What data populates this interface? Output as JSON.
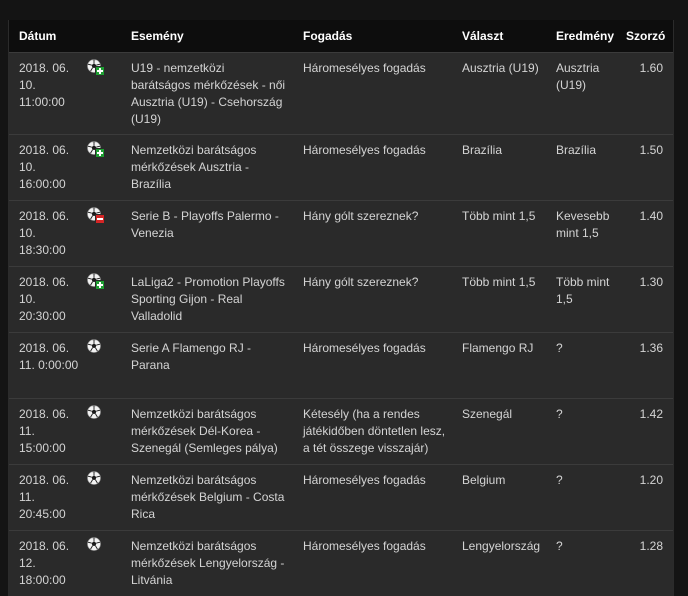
{
  "headers": {
    "date": "Dátum",
    "event": "Esemény",
    "bet": "Fogadás",
    "choice": "Választ",
    "result": "Eredmény",
    "odds": "Szorzó"
  },
  "rows": [
    {
      "date": "2018. 06. 10. 11:00:00",
      "status": "win",
      "icon": "soccer-ball-icon",
      "event": "U19 - nemzetközi barátságos mérkőzések - női Ausztria (U19) - Csehország (U19)",
      "bet": "Háromesélyes fogadás",
      "choice": "Ausztria (U19)",
      "result": "Ausztria (U19)",
      "odds": "1.60"
    },
    {
      "date": "2018. 06. 10. 16:00:00",
      "status": "win",
      "icon": "soccer-ball-icon",
      "event": "Nemzetközi barátságos mérkőzések Ausztria - Brazília",
      "bet": "Háromesélyes fogadás",
      "choice": "Brazília",
      "result": "Brazília",
      "odds": "1.50"
    },
    {
      "date": "2018. 06. 10. 18:30:00",
      "status": "lose",
      "icon": "soccer-ball-icon",
      "event": "Serie B - Playoffs Palermo - Venezia",
      "bet": "Hány gólt szereznek?",
      "choice": "Több mint 1,5",
      "result": "Kevesebb mint 1,5",
      "odds": "1.40"
    },
    {
      "date": "2018. 06. 10. 20:30:00",
      "status": "win",
      "icon": "soccer-ball-icon",
      "event": "LaLiga2 - Promotion Playoffs Sporting Gijon - Real Valladolid",
      "bet": "Hány gólt szereznek?",
      "choice": "Több mint 1,5",
      "result": "Több mint 1,5",
      "odds": "1.30"
    },
    {
      "date": "2018. 06. 11. 0:00:00",
      "status": "none",
      "icon": "soccer-ball-icon",
      "event": "Serie A Flamengo RJ - Parana",
      "bet": "Háromesélyes fogadás",
      "choice": "Flamengo RJ",
      "result": "?",
      "odds": "1.36"
    },
    {
      "date": "2018. 06. 11. 15:00:00",
      "status": "none",
      "icon": "soccer-ball-icon",
      "event": "Nemzetközi barátságos mérkőzések Dél-Korea - Szenegál (Semleges pálya)",
      "bet": "Kétesély (ha a rendes játékidőben döntetlen lesz, a tét összege visszajár)",
      "choice": "Szenegál",
      "result": "?",
      "odds": "1.42"
    },
    {
      "date": "2018. 06. 11. 20:45:00",
      "status": "none",
      "icon": "soccer-ball-icon",
      "event": "Nemzetközi barátságos mérkőzések Belgium - Costa Rica",
      "bet": "Háromesélyes fogadás",
      "choice": "Belgium",
      "result": "?",
      "odds": "1.20"
    },
    {
      "date": "2018. 06. 12. 18:00:00",
      "status": "none",
      "icon": "soccer-ball-icon",
      "event": "Nemzetközi barátságos mérkőzések Lengyelország - Litvánia",
      "bet": "Háromesélyes fogadás",
      "choice": "Lengyelország",
      "result": "?",
      "odds": "1.28"
    }
  ],
  "colors": {
    "win": "#1e9e32",
    "lose": "#d42525",
    "row_bg": "#2a2a2a",
    "header_bg": "#0d0d0d"
  }
}
